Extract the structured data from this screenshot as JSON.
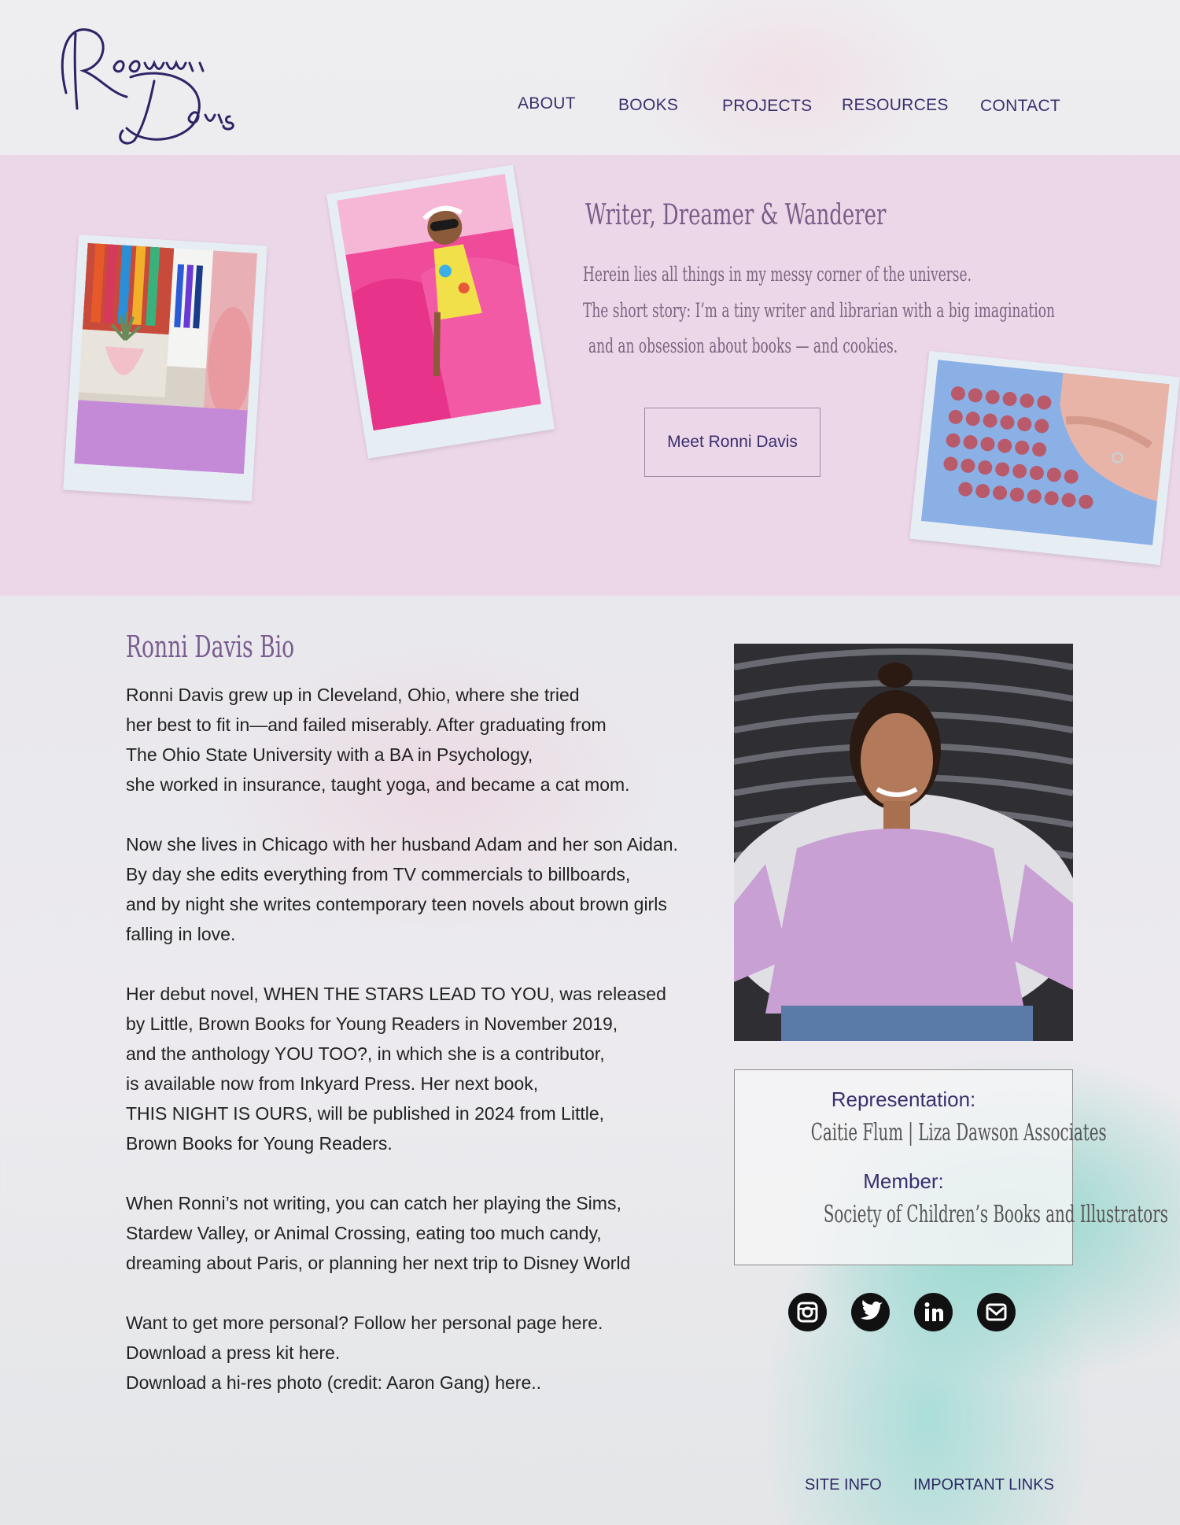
{
  "header": {
    "logo_text": "Ronni Davis",
    "nav": [
      "ABOUT",
      "BOOKS",
      "PROJECTS",
      "RESOURCES",
      "CONTACT"
    ]
  },
  "hero": {
    "title": "Writer, Dreamer & Wanderer",
    "lines": [
      "Herein lies all things in my messy corner of the universe.",
      "The short story: I’m a tiny writer and librarian with a big imagination",
      "and an obsession about books — and cookies."
    ],
    "button_label": "Meet Ronni Davis"
  },
  "bio": {
    "title": "Ronni Davis Bio",
    "lines": [
      "Ronni Davis grew up in Cleveland, Ohio, where she tried",
      "her best to fit in—and failed miserably. After graduating from",
      "The Ohio State University with a BA in Psychology,",
      "she worked in insurance, taught yoga, and became a cat mom.",
      "Now she lives in Chicago with her husband Adam and her son Aidan.",
      "By day she edits everything from TV commercials to billboards,",
      "and by night she writes contemporary teen novels about brown girls",
      "falling in love.",
      "Her debut novel, WHEN THE STARS LEAD TO YOU, was released",
      "by Little, Brown Books for Young Readers in November 2019,",
      "and the anthology YOU TOO?, in which she is a contributor,",
      "is available now from Inkyard Press. Her next book,",
      "THIS NIGHT IS OURS, will be published in 2024 from Little,",
      "Brown Books for Young Readers.",
      "When Ronni’s not writing, you can catch her playing the Sims,",
      "Stardew Valley, or Animal Crossing, eating too much candy,",
      "dreaming about Paris, or planning her next trip to Disney World",
      "Want to get more personal? Follow her personal page here.",
      "Download a press kit here.",
      "Download a hi-res photo (credit: Aaron Gang) here.."
    ]
  },
  "sidebar": {
    "representation_label": "Representation:",
    "representation_value": "Caitie Flum | Liza Dawson Associates",
    "member_label": "Member:",
    "member_value": "Society of Children’s Books and Illustrators",
    "social": [
      "instagram-icon",
      "twitter-icon",
      "linkedin-icon",
      "email-icon"
    ]
  },
  "footer": {
    "links": [
      "SITE INFO",
      "IMPORTANT LINKS"
    ]
  },
  "colors": {
    "hero_bg": "#ecd7e8",
    "nav_text": "#3a2f6e",
    "heading_purple": "#7a5c90"
  }
}
